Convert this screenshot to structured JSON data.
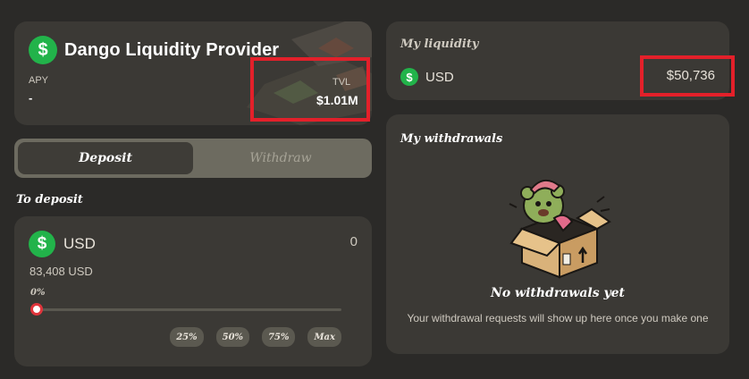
{
  "pool": {
    "title": "Dango Liquidity Provider",
    "coin_symbol": "$",
    "apy_label": "APY",
    "apy_value": "-",
    "tvl_label": "TVL",
    "tvl_value": "$1.01M"
  },
  "tabs": [
    {
      "label": "Deposit",
      "active": true
    },
    {
      "label": "Withdraw",
      "active": false
    }
  ],
  "deposit": {
    "section_label": "To deposit",
    "token": "USD",
    "coin_symbol": "$",
    "amount": "0",
    "balance": "83,408 USD",
    "percent": "0%",
    "slider_fraction": 0,
    "pct_buttons": [
      "25%",
      "50%",
      "75%",
      "Max"
    ]
  },
  "liquidity": {
    "title": "My liquidity",
    "coin_symbol": "$",
    "token": "USD",
    "value": "$50,736"
  },
  "withdrawals": {
    "title": "My withdrawals",
    "empty_title": "No withdrawals yet",
    "empty_subtitle": "Your withdrawal requests will show up here once you make one"
  },
  "colors": {
    "coin_green": "#22b34a",
    "highlight_red": "#e3202a",
    "card_bg": "#3b3935",
    "page_bg": "#2b2a28"
  }
}
